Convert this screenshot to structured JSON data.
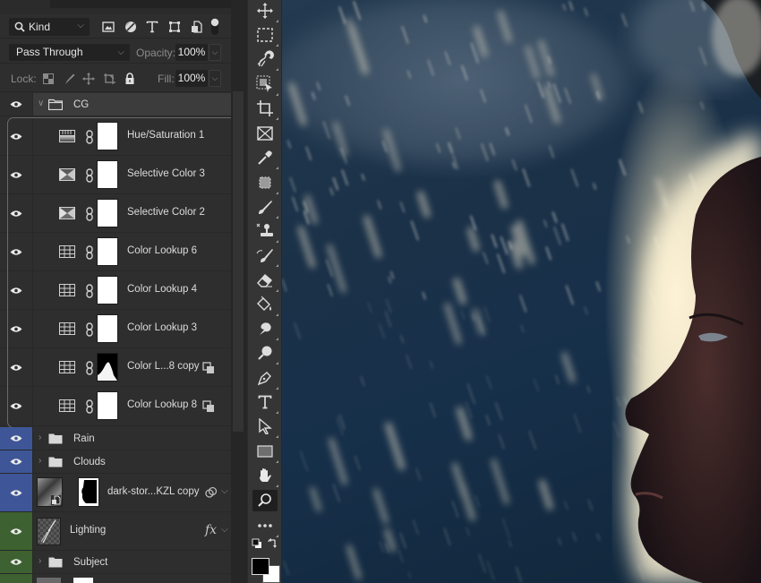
{
  "layers_panel": {
    "filter": {
      "kind_label": "Kind",
      "filter_icons": [
        "pixel-layer-filter-icon",
        "adjustment-layer-filter-icon",
        "type-layer-filter-icon",
        "shape-layer-filter-icon",
        "smart-object-filter-icon",
        "filter-toggle-icon"
      ]
    },
    "blend_mode": "Pass Through",
    "opacity_label": "Opacity:",
    "opacity_value": "100%",
    "lock_label": "Lock:",
    "fill_label": "Fill:",
    "fill_value": "100%",
    "layers": [
      {
        "name": "CG",
        "type": "group",
        "expanded": true,
        "label_color": "none"
      },
      {
        "name": "Hue/Saturation 1",
        "type": "adjustment",
        "adjustment": "hue-saturation",
        "clipped": true
      },
      {
        "name": "Selective Color 3",
        "type": "adjustment",
        "adjustment": "selective-color",
        "clipped": true
      },
      {
        "name": "Selective Color 2",
        "type": "adjustment",
        "adjustment": "selective-color",
        "clipped": true
      },
      {
        "name": "Color Lookup 6",
        "type": "adjustment",
        "adjustment": "color-lookup",
        "clipped": true
      },
      {
        "name": "Color Lookup 4",
        "type": "adjustment",
        "adjustment": "color-lookup",
        "clipped": true
      },
      {
        "name": "Color Lookup 3",
        "type": "adjustment",
        "adjustment": "color-lookup",
        "clipped": true
      },
      {
        "name": "Color L...8 copy",
        "type": "adjustment",
        "adjustment": "color-lookup",
        "clipped": true,
        "mask": "custom",
        "badge": "smart-object"
      },
      {
        "name": "Color Lookup 8",
        "type": "adjustment",
        "adjustment": "color-lookup",
        "clipped": true,
        "badge": "smart-object"
      },
      {
        "name": "Rain",
        "type": "group",
        "expanded": false,
        "label_color": "blue"
      },
      {
        "name": "Clouds",
        "type": "group",
        "expanded": false,
        "label_color": "blue"
      },
      {
        "name": "dark-stor...KZL copy",
        "type": "smart-object",
        "label_color": "blue",
        "badge": "blend-if"
      },
      {
        "name": "Lighting",
        "type": "pixel",
        "label_color": "green",
        "badge": "fx"
      },
      {
        "name": "Subject",
        "type": "group",
        "expanded": false,
        "label_color": "green"
      }
    ],
    "fx_label": "fx"
  },
  "toolbar": {
    "tools": [
      "move-tool",
      "marquee-tool",
      "lasso-tool",
      "object-selection-tool",
      "crop-tool",
      "frame-tool",
      "eyedropper-tool",
      "healing-brush-tool",
      "brush-tool",
      "clone-stamp-tool",
      "history-brush-tool",
      "eraser-tool",
      "paint-bucket-tool",
      "smudge-tool",
      "dodge-tool",
      "pen-tool",
      "type-tool",
      "path-selection-tool",
      "rectangle-tool",
      "hand-tool",
      "zoom-tool",
      "more-tools"
    ],
    "active_tool": "zoom-tool",
    "foreground_color": "#000000",
    "background_color": "#ffffff"
  },
  "colors": {
    "label_blue": "#3e5698",
    "label_green": "#3d6130",
    "panel_bg": "#2e2e2e"
  }
}
